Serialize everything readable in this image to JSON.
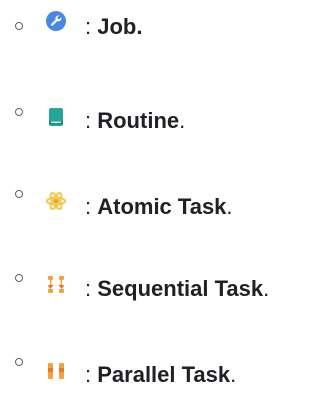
{
  "legend": {
    "separator": ":",
    "items": [
      {
        "icon": "wrench-icon",
        "icon_color": "#4a86e8",
        "name": "Job",
        "suffix": "."
      },
      {
        "icon": "book-icon",
        "icon_color": "#26a69a",
        "name": "Routine",
        "suffix": "."
      },
      {
        "icon": "atom-icon",
        "icon_color": "#f2c94c",
        "name": "Atomic Task",
        "suffix": "."
      },
      {
        "icon": "sequential-icon",
        "icon_color": "#f2a33a",
        "name": "Sequential Task",
        "suffix": "."
      },
      {
        "icon": "parallel-icon",
        "icon_color": "#f2a33a",
        "name": "Parallel Task",
        "suffix": "."
      }
    ]
  }
}
